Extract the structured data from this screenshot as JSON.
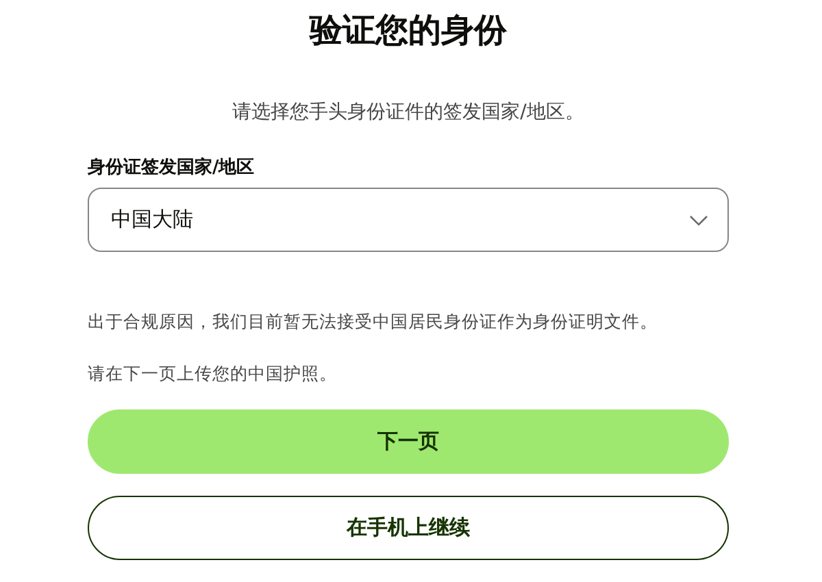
{
  "title": "验证您的身份",
  "subtitle": "请选择您手头身份证件的签发国家/地区。",
  "country_field": {
    "label": "身份证签发国家/地区",
    "value": "中国大陆"
  },
  "notes": [
    "出于合规原因，我们目前暂无法接受中国居民身份证作为身份证明文件。",
    "请在下一页上传您的中国护照。"
  ],
  "buttons": [
    {
      "label": "下一页",
      "kind": "primary"
    },
    {
      "label": "在手机上继续",
      "kind": "secondary"
    }
  ]
}
